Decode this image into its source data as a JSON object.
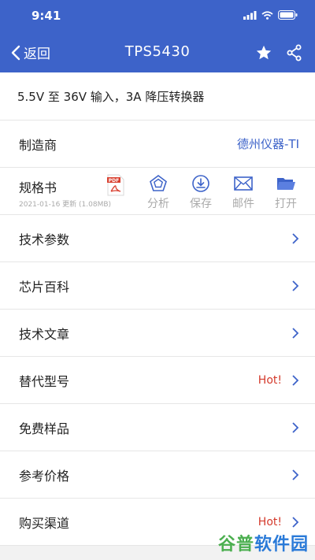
{
  "status": {
    "time": "9:41"
  },
  "nav": {
    "back_label": "返回",
    "title": "TPS5430"
  },
  "description": "5.5V 至 36V 输入，3A 降压转换器",
  "manufacturer": {
    "label": "制造商",
    "value": "德州仪器-TI"
  },
  "spec": {
    "label": "规格书",
    "meta": "2021-01-16 更新 (1.08MB)",
    "pdf_badge": "PDF",
    "actions": [
      {
        "label": "分析",
        "icon": "pentagon-icon"
      },
      {
        "label": "保存",
        "icon": "download-icon"
      },
      {
        "label": "邮件",
        "icon": "mail-icon"
      },
      {
        "label": "打开",
        "icon": "folder-icon"
      }
    ]
  },
  "menu": [
    {
      "label": "技术参数",
      "hot": ""
    },
    {
      "label": "芯片百科",
      "hot": ""
    },
    {
      "label": "技术文章",
      "hot": ""
    },
    {
      "label": "替代型号",
      "hot": "Hot!"
    },
    {
      "label": "免费样品",
      "hot": ""
    },
    {
      "label": "参考价格",
      "hot": ""
    },
    {
      "label": "购买渠道",
      "hot": "Hot!"
    }
  ],
  "watermark": {
    "part1": "谷普",
    "part2": "软件园"
  },
  "colors": {
    "header": "#3d63c9",
    "hot": "#d43a2c",
    "link": "#3d63c9"
  }
}
